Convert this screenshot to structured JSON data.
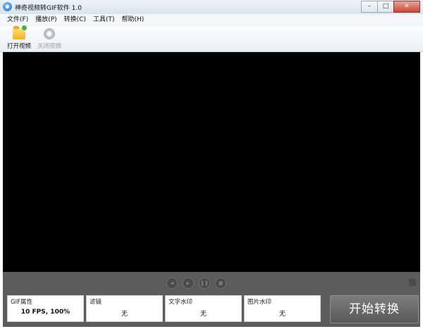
{
  "window": {
    "title": "神奇视频转GIF软件 1.0",
    "minimize": "–",
    "maximize": "□",
    "close": "✕"
  },
  "menu": [
    "文件(F)",
    "播放(P)",
    "转换(C)",
    "工具(T)",
    "帮助(H)"
  ],
  "toolbar": {
    "open_label": "打开视频",
    "close_label": "关闭视频",
    "close_enabled": false
  },
  "controls": {
    "prev": "◀",
    "play": "▶",
    "pause": "❚❚",
    "stop": "■"
  },
  "panels": [
    {
      "title": "GIF属性",
      "value": "10 FPS, 100%"
    },
    {
      "title": "滤镜",
      "value": "无"
    },
    {
      "title": "文字水印",
      "value": "无"
    },
    {
      "title": "图片水印",
      "value": "无"
    }
  ],
  "start_button": "开始转换",
  "colors": {
    "video_bg": "#000000",
    "bottom_bg": "#5c5c5c",
    "close_btn": "#c8473a"
  }
}
